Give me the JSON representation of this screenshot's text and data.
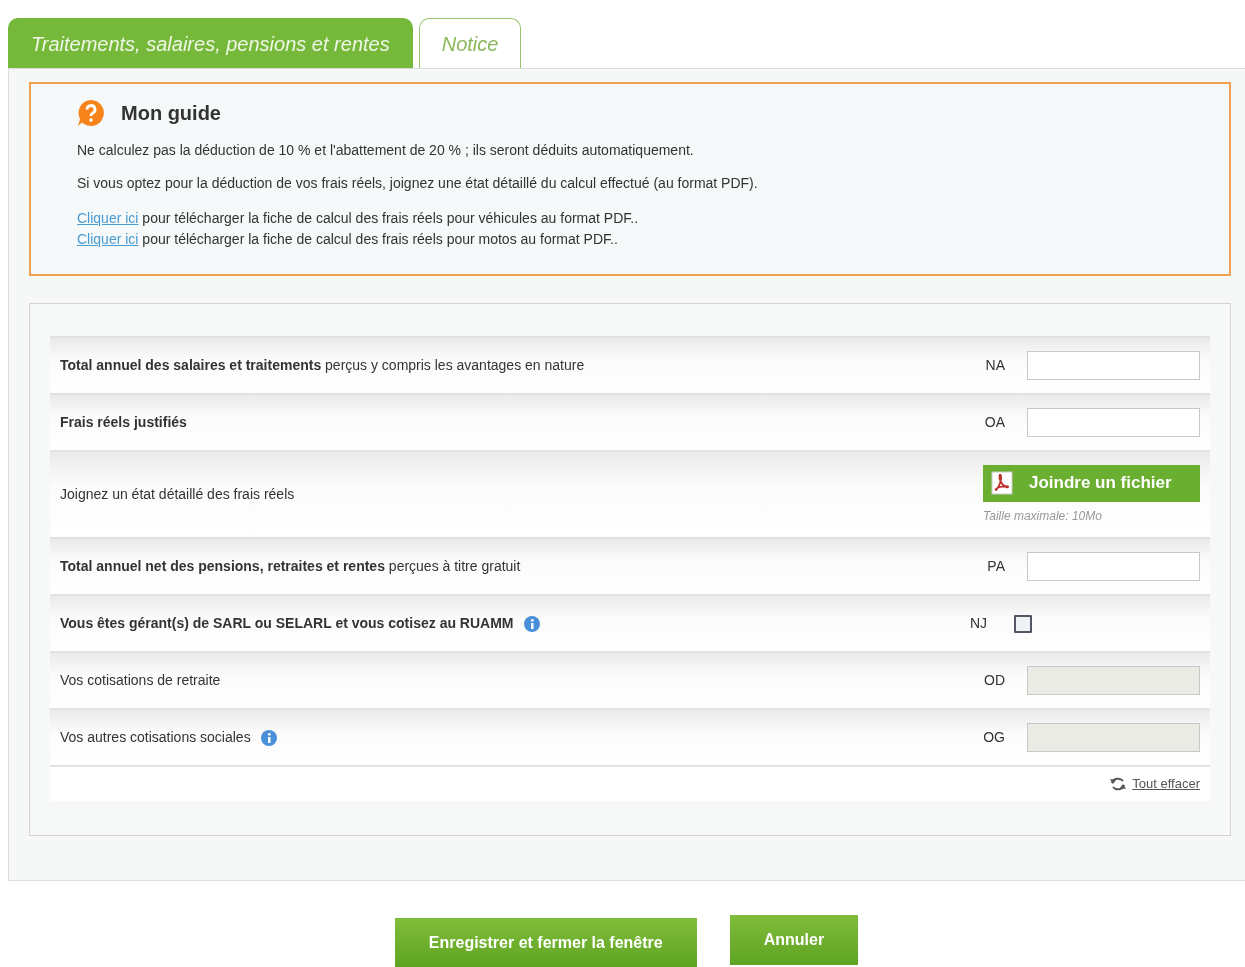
{
  "tabs": [
    {
      "label": "Traitements, salaires, pensions et rentes",
      "selected": true
    },
    {
      "label": "Notice",
      "selected": false
    }
  ],
  "guide": {
    "title": "Mon guide",
    "paragraphs": [
      "Ne calculez pas la déduction de 10 % et l'abattement de 20 % ; ils seront déduits automatiquement.",
      "Si vous optez pour la déduction de vos frais réels, joignez une état détaillé du calcul effectué (au format PDF)."
    ],
    "links": [
      {
        "link": "Cliquer ici",
        "text": " pour télécharger la fiche de calcul des frais réels pour véhicules au format PDF.."
      },
      {
        "link": "Cliquer ici",
        "text": " pour télécharger la fiche de calcul des frais réels pour motos au format PDF.."
      }
    ]
  },
  "rows": [
    {
      "kind": "input",
      "label": "**Total annuel des salaires et traitements** perçus y compris les avantages en nature",
      "code": "NA",
      "disabled": false
    },
    {
      "kind": "input",
      "label": "**Frais réels justifiés**",
      "code": "OA",
      "disabled": false
    },
    {
      "kind": "file",
      "label": "Joignez un état détaillé des frais réels",
      "button": "Joindre un fichier",
      "hint": "Taille maximale: 10Mo"
    },
    {
      "kind": "input",
      "label": "**Total annuel net des pensions, retraites et rentes** perçues à titre gratuit",
      "code": "PA",
      "disabled": false
    },
    {
      "kind": "checkbox",
      "label": "**Vous êtes gérant(s) de SARL ou SELARL et vous cotisez au RUAMM**",
      "info": true,
      "code": "NJ",
      "checked": false
    },
    {
      "kind": "input",
      "label": "Vos cotisations de retraite",
      "code": "OD",
      "disabled": true
    },
    {
      "kind": "input",
      "label": "Vos autres cotisations sociales",
      "info": true,
      "code": "OG",
      "disabled": true
    }
  ],
  "clear_link": "Tout effacer",
  "buttons": [
    "Enregistrer et fermer la fenêtre",
    "Annuler"
  ]
}
